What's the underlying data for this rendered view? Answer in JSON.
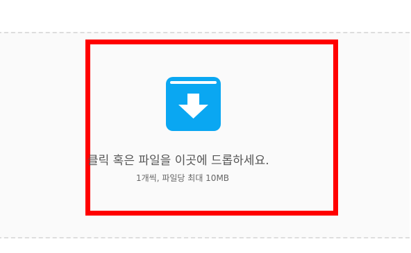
{
  "uploader": {
    "main_text": "클릭 혹은 파일을 이곳에 드롭하세요.",
    "sub_text": "1개씩, 파일당 최대 10MB",
    "icon": "download-box-icon"
  },
  "colors": {
    "accent": "#0aa7f2",
    "dropzone_bg": "#fafafa",
    "dropzone_border": "#dddddd",
    "highlight": "#ff0000"
  }
}
